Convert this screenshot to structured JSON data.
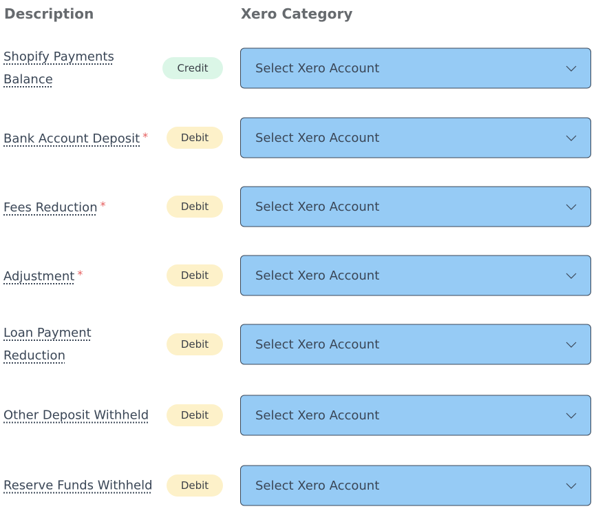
{
  "header": {
    "description_label": "Description",
    "category_label": "Xero Category"
  },
  "colors": {
    "credit_badge_bg": "#dbf6e7",
    "debit_badge_bg": "#fdf1c9",
    "select_bg": "#96cbf5",
    "required_asterisk": "#e55d5d"
  },
  "rows": [
    {
      "description": "Shopify Payments Balance",
      "required": false,
      "type": "Credit",
      "select_value": "Select Xero Account",
      "chevron_icon": "chevron-down-icon"
    },
    {
      "description": "Bank Account Deposit",
      "required": true,
      "type": "Debit",
      "select_value": "Select Xero Account",
      "chevron_icon": "chevron-down-icon"
    },
    {
      "description": "Fees Reduction",
      "required": true,
      "type": "Debit",
      "select_value": "Select Xero Account",
      "chevron_icon": "chevron-down-icon"
    },
    {
      "description": "Adjustment",
      "required": true,
      "type": "Debit",
      "select_value": "Select Xero Account",
      "chevron_icon": "chevron-down-icon"
    },
    {
      "description": "Loan Payment Reduction",
      "required": false,
      "type": "Debit",
      "select_value": "Select Xero Account",
      "chevron_icon": "chevron-down-icon"
    },
    {
      "description": "Other Deposit Withheld",
      "required": false,
      "type": "Debit",
      "select_value": "Select Xero Account",
      "chevron_icon": "chevron-down-icon"
    },
    {
      "description": "Reserve Funds Withheld",
      "required": false,
      "type": "Debit",
      "select_value": "Select Xero Account",
      "chevron_icon": "chevron-down-icon"
    }
  ],
  "required_marker": "*"
}
